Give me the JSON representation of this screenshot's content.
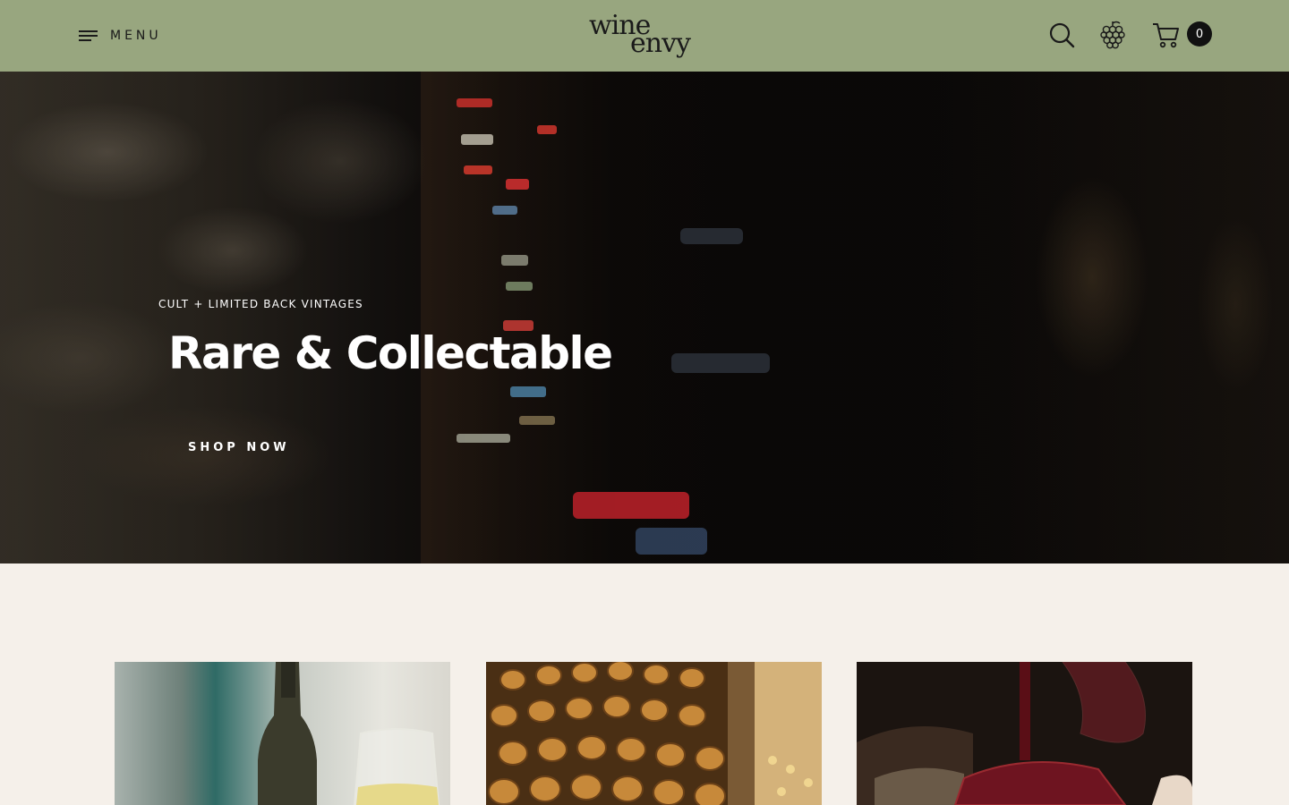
{
  "header": {
    "menu_label": "MENU",
    "logo_line1": "wine",
    "logo_line2": "envy",
    "cart_count": "0",
    "background_color": "#98a67f",
    "icons": [
      "hamburger-icon",
      "search-icon",
      "grape-icon",
      "cart-icon"
    ]
  },
  "hero": {
    "eyebrow": "CULT + LIMITED BACK VINTAGES",
    "title": "Rare & Collectable",
    "cta_label": "SHOP NOW"
  },
  "page": {
    "background_color": "#f5f0ea"
  }
}
